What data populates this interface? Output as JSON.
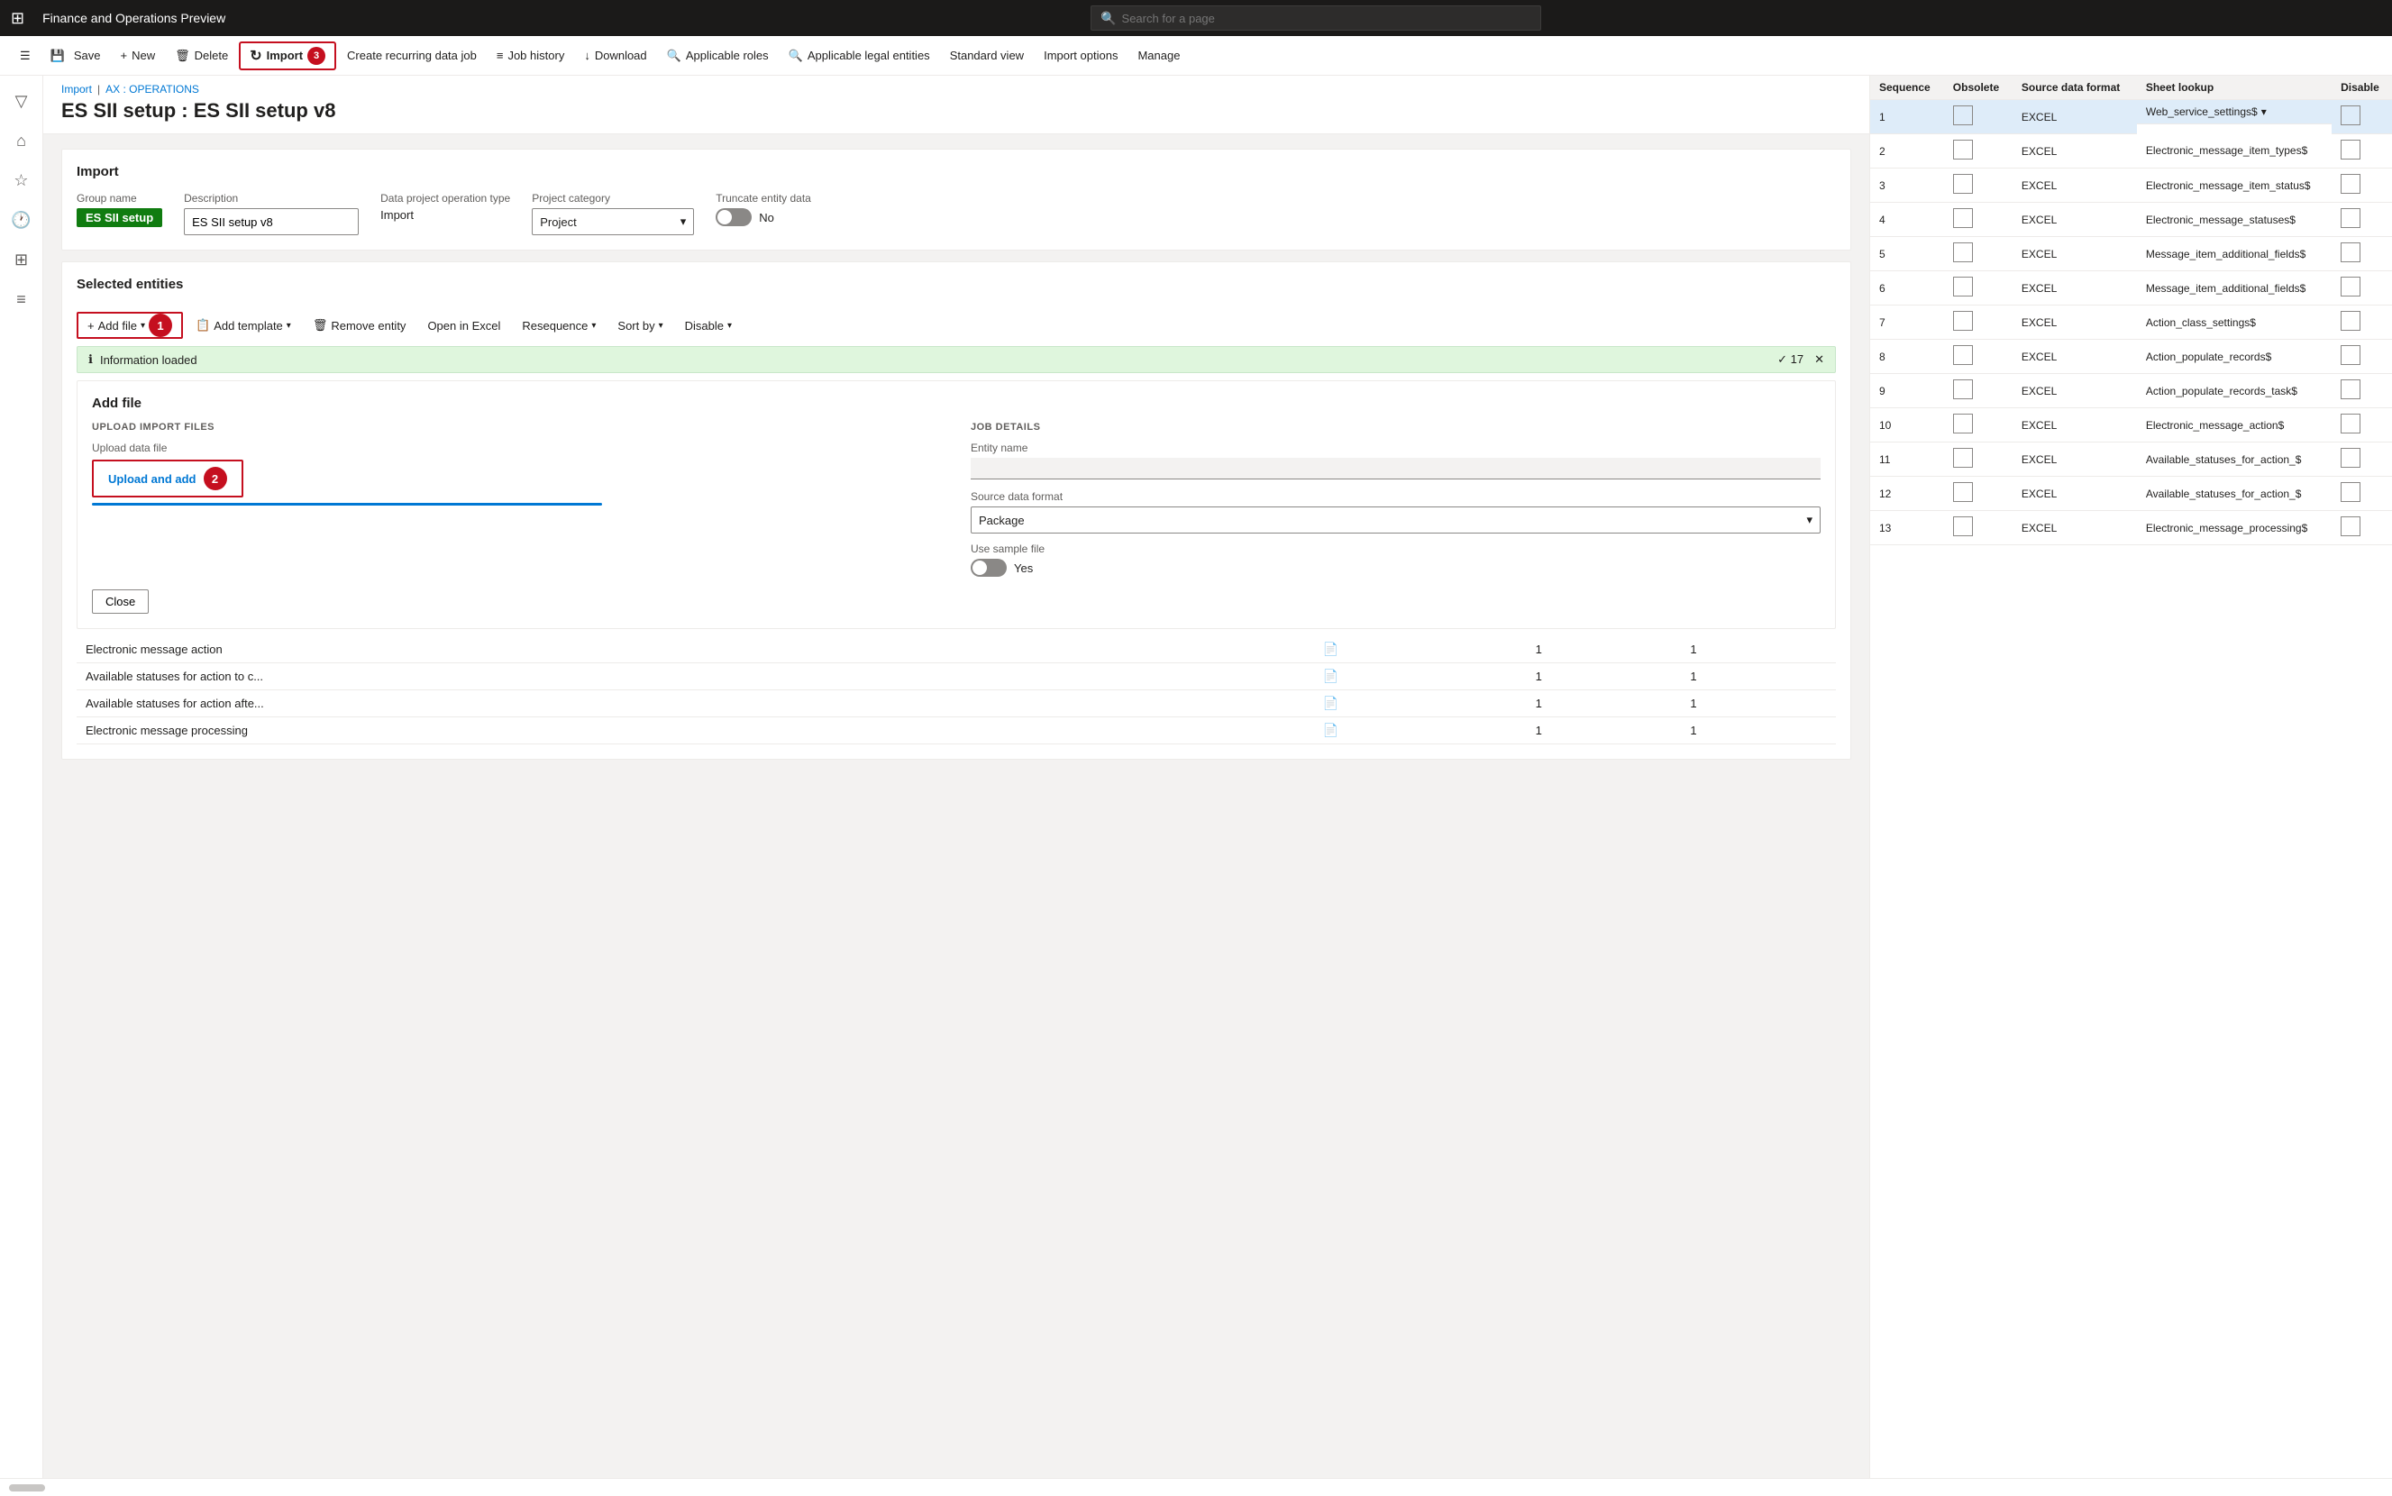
{
  "topbar": {
    "logo": "⊞",
    "title": "Finance and Operations Preview",
    "search_placeholder": "Search for a page"
  },
  "commandbar": {
    "buttons": [
      {
        "id": "hamburger",
        "icon": "☰",
        "label": "",
        "has_icon_only": true
      },
      {
        "id": "save",
        "icon": "💾",
        "label": "Save"
      },
      {
        "id": "new",
        "icon": "+",
        "label": "New"
      },
      {
        "id": "delete",
        "icon": "🗑",
        "label": "Delete"
      },
      {
        "id": "import",
        "icon": "↻",
        "label": "Import",
        "highlighted": true,
        "badge": "3"
      },
      {
        "id": "recurring",
        "icon": "",
        "label": "Create recurring data job"
      },
      {
        "id": "job-history",
        "icon": "≡",
        "label": "Job history"
      },
      {
        "id": "download",
        "icon": "↓",
        "label": "Download"
      },
      {
        "id": "applicable-roles",
        "icon": "🔍",
        "label": "Applicable roles"
      },
      {
        "id": "applicable-legal",
        "icon": "🔍",
        "label": "Applicable legal entities"
      },
      {
        "id": "standard-view",
        "icon": "",
        "label": "Standard view"
      },
      {
        "id": "import-options",
        "icon": "",
        "label": "Import options"
      },
      {
        "id": "manage",
        "icon": "",
        "label": "Manage"
      }
    ]
  },
  "sidebar": {
    "icons": [
      {
        "id": "home",
        "symbol": "⌂"
      },
      {
        "id": "star",
        "symbol": "★"
      },
      {
        "id": "clock",
        "symbol": "🕐"
      },
      {
        "id": "grid",
        "symbol": "⊞"
      },
      {
        "id": "list",
        "symbol": "≡"
      }
    ]
  },
  "breadcrumb": {
    "items": [
      "Import",
      "AX : OPERATIONS"
    ]
  },
  "page_title": "ES SII setup : ES SII setup v8",
  "import_section": {
    "title": "Import",
    "group_name_label": "Group name",
    "group_name_value": "ES SII setup",
    "description_label": "Description",
    "description_value": "ES SII setup v8",
    "operation_type_label": "Data project operation type",
    "operation_type_value": "Import",
    "project_category_label": "Project category",
    "project_category_value": "Project",
    "truncate_label": "Truncate entity data",
    "truncate_value": "No"
  },
  "selected_entities": {
    "title": "Selected entities",
    "toolbar": {
      "add_file": "+ Add file",
      "add_template": "Add template",
      "remove_entity": "Remove entity",
      "open_excel": "Open in Excel",
      "resequence": "Resequence",
      "sort_by": "Sort by",
      "disable": "Disable"
    },
    "info_bar": {
      "icon": "ℹ",
      "text": "Information loaded",
      "count": "17",
      "close": "✕"
    }
  },
  "add_file_panel": {
    "title": "Add file",
    "upload_section_title": "UPLOAD IMPORT FILES",
    "job_details_title": "JOB DETAILS",
    "upload_data_file_label": "Upload data file",
    "upload_btn_label": "Upload and add",
    "upload_badge": "2",
    "entity_name_label": "Entity name",
    "entity_name_placeholder": "",
    "source_format_label": "Source data format",
    "source_format_value": "Package",
    "use_sample_label": "Use sample file",
    "use_sample_value": "Yes",
    "close_btn": "Close"
  },
  "entity_table": {
    "rows": [
      {
        "name": "Electronic message action",
        "icon": "📄",
        "col1": "1",
        "col2": "1"
      },
      {
        "name": "Available statuses for action to c...",
        "icon": "📄",
        "col1": "1",
        "col2": "1"
      },
      {
        "name": "Available statuses for action afte...",
        "icon": "📄",
        "col1": "1",
        "col2": "1"
      },
      {
        "name": "Electronic message processing",
        "icon": "📄",
        "col1": "1",
        "col2": "1"
      }
    ]
  },
  "right_panel": {
    "columns": {
      "sequence": "Sequence",
      "obsolete": "Obsolete",
      "source_data_format": "Source data format",
      "sheet_lookup": "Sheet lookup",
      "disable": "Disable"
    },
    "rows": [
      {
        "seq": "1",
        "obsolete": false,
        "format": "EXCEL",
        "sheet": "Web_service_settings$",
        "has_dropdown": true,
        "selected": true
      },
      {
        "seq": "2",
        "obsolete": false,
        "format": "EXCEL",
        "sheet": "Electronic_message_item_types$",
        "has_dropdown": false,
        "selected": false
      },
      {
        "seq": "3",
        "obsolete": false,
        "format": "EXCEL",
        "sheet": "Electronic_message_item_status$",
        "has_dropdown": false,
        "selected": false
      },
      {
        "seq": "4",
        "obsolete": false,
        "format": "EXCEL",
        "sheet": "Electronic_message_statuses$",
        "has_dropdown": false,
        "selected": false
      },
      {
        "seq": "5",
        "obsolete": false,
        "format": "EXCEL",
        "sheet": "Message_item_additional_fields$",
        "has_dropdown": false,
        "selected": false
      },
      {
        "seq": "6",
        "obsolete": false,
        "format": "EXCEL",
        "sheet": "Message_item_additional_fields$",
        "has_dropdown": false,
        "selected": false
      },
      {
        "seq": "7",
        "obsolete": false,
        "format": "EXCEL",
        "sheet": "Action_class_settings$",
        "has_dropdown": false,
        "selected": false
      },
      {
        "seq": "8",
        "obsolete": false,
        "format": "EXCEL",
        "sheet": "Action_populate_records$",
        "has_dropdown": false,
        "selected": false
      },
      {
        "seq": "9",
        "obsolete": false,
        "format": "EXCEL",
        "sheet": "Action_populate_records_task$",
        "has_dropdown": false,
        "selected": false
      },
      {
        "seq": "10",
        "obsolete": false,
        "format": "EXCEL",
        "sheet": "Electronic_message_action$",
        "has_dropdown": false,
        "selected": false
      },
      {
        "seq": "11",
        "obsolete": false,
        "format": "EXCEL",
        "sheet": "Available_statuses_for_action_$",
        "has_dropdown": false,
        "selected": false
      },
      {
        "seq": "12",
        "obsolete": false,
        "format": "EXCEL",
        "sheet": "Available_statuses_for_action_$",
        "has_dropdown": false,
        "selected": false
      },
      {
        "seq": "13",
        "obsolete": false,
        "format": "EXCEL",
        "sheet": "Electronic_message_processing$",
        "has_dropdown": false,
        "selected": false
      }
    ]
  }
}
